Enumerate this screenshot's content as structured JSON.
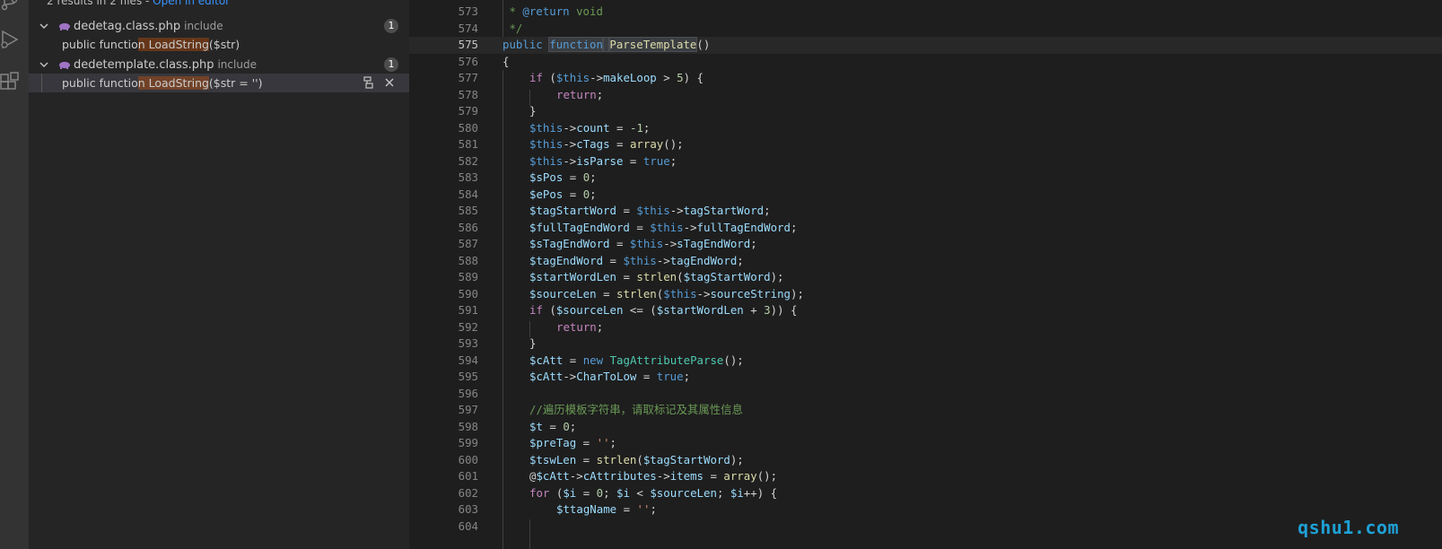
{
  "search": {
    "summary": "2 results in 2 files - ",
    "open_in_editor": "Open in editor",
    "files": [
      {
        "name": "dedetag.class.php",
        "dir": "include",
        "count": "1",
        "match": {
          "before": "public functio",
          "highlight": "n LoadString",
          "after": "($str)"
        }
      },
      {
        "name": "dedetemplate.class.php",
        "dir": "include",
        "count": "1",
        "match": {
          "before": "public functio",
          "highlight": "n LoadString",
          "after": "($str = '')"
        }
      }
    ]
  },
  "activity_bar": {
    "icons": [
      "source-control-icon",
      "run-debug-icon",
      "extensions-icon"
    ]
  },
  "editor": {
    "line_numbers": [
      "573",
      "574",
      "575",
      "576",
      "577",
      "578",
      "579",
      "580",
      "581",
      "582",
      "583",
      "584",
      "585",
      "586",
      "587",
      "588",
      "589",
      "590",
      "591",
      "592",
      "593",
      "594",
      "595",
      "596",
      "597",
      "598",
      "599",
      "600",
      "601",
      "602",
      "603",
      "604"
    ],
    "current_line": "575",
    "code": {
      "l573": {
        "t1": " * ",
        "t2": "@return",
        "t3": " void"
      },
      "l574": {
        "t1": " */"
      },
      "l575": {
        "t1": "public",
        "t2": " ",
        "t3": "function",
        "t4": " ",
        "t5": "ParseTemplate",
        "t6": "()"
      },
      "l576": {
        "t1": "{"
      },
      "l577": {
        "t1": "if",
        "t2": " (",
        "t3": "$this",
        "t4": "->",
        "t5": "makeLoop",
        "t6": " > ",
        "t7": "5",
        "t8": ") {"
      },
      "l578": {
        "t1": "return",
        "t2": ";"
      },
      "l579": {
        "t1": "}"
      },
      "l580": {
        "t1": "$this",
        "t2": "->",
        "t3": "count",
        "t4": " = ",
        "t5": "-1",
        "t6": ";"
      },
      "l581": {
        "t1": "$this",
        "t2": "->",
        "t3": "cTags",
        "t4": " = ",
        "t5": "array",
        "t6": "();"
      },
      "l582": {
        "t1": "$this",
        "t2": "->",
        "t3": "isParse",
        "t4": " = ",
        "t5": "true",
        "t6": ";"
      },
      "l583": {
        "t1": "$sPos",
        "t2": " = ",
        "t3": "0",
        "t4": ";"
      },
      "l584": {
        "t1": "$ePos",
        "t2": " = ",
        "t3": "0",
        "t4": ";"
      },
      "l585": {
        "t1": "$tagStartWord",
        "t2": " = ",
        "t3": "$this",
        "t4": "->",
        "t5": "tagStartWord",
        "t6": ";"
      },
      "l586": {
        "t1": "$fullTagEndWord",
        "t2": " = ",
        "t3": "$this",
        "t4": "->",
        "t5": "fullTagEndWord",
        "t6": ";"
      },
      "l587": {
        "t1": "$sTagEndWord",
        "t2": " = ",
        "t3": "$this",
        "t4": "->",
        "t5": "sTagEndWord",
        "t6": ";"
      },
      "l588": {
        "t1": "$tagEndWord",
        "t2": " = ",
        "t3": "$this",
        "t4": "->",
        "t5": "tagEndWord",
        "t6": ";"
      },
      "l589": {
        "t1": "$startWordLen",
        "t2": " = ",
        "t3": "strlen",
        "t4": "(",
        "t5": "$tagStartWord",
        "t6": ");"
      },
      "l590": {
        "t1": "$sourceLen",
        "t2": " = ",
        "t3": "strlen",
        "t4": "(",
        "t5": "$this",
        "t6": "->",
        "t7": "sourceString",
        "t8": ");"
      },
      "l591": {
        "t1": "if",
        "t2": " (",
        "t3": "$sourceLen",
        "t4": " <= (",
        "t5": "$startWordLen",
        "t6": " + ",
        "t7": "3",
        "t8": ")) {"
      },
      "l592": {
        "t1": "return",
        "t2": ";"
      },
      "l593": {
        "t1": "}"
      },
      "l594": {
        "t1": "$cAtt",
        "t2": " = ",
        "t3": "new",
        "t4": " ",
        "t5": "TagAttributeParse",
        "t6": "();"
      },
      "l595": {
        "t1": "$cAtt",
        "t2": "->",
        "t3": "CharToLow",
        "t4": " = ",
        "t5": "true",
        "t6": ";"
      },
      "l596": {},
      "l597": {
        "t1": "//遍历模板字符串，请取标记及其属性信息"
      },
      "l598": {
        "t1": "$t",
        "t2": " = ",
        "t3": "0",
        "t4": ";"
      },
      "l599": {
        "t1": "$preTag",
        "t2": " = ",
        "t3": "''",
        "t4": ";"
      },
      "l600": {
        "t1": "$tswLen",
        "t2": " = ",
        "t3": "strlen",
        "t4": "(",
        "t5": "$tagStartWord",
        "t6": ");"
      },
      "l601": {
        "t1": "@",
        "t2": "$cAtt",
        "t3": "->",
        "t4": "cAttributes",
        "t5": "->",
        "t6": "items",
        "t7": " = ",
        "t8": "array",
        "t9": "();"
      },
      "l602": {
        "t1": "for",
        "t2": " (",
        "t3": "$i",
        "t4": " = ",
        "t5": "0",
        "t6": "; ",
        "t7": "$i",
        "t8": " < ",
        "t9": "$sourceLen",
        "t10": "; ",
        "t11": "$i",
        "t12": "++) {"
      },
      "l603": {
        "t1": "$ttagName",
        "t2": " = ",
        "t3": "''",
        "t4": ";"
      },
      "l604": {}
    }
  },
  "watermark": "qshu1.com",
  "colors": {
    "accent_link": "#3794ff",
    "match_highlight": "#ea5c00",
    "watermark": "#1ea1d6"
  }
}
